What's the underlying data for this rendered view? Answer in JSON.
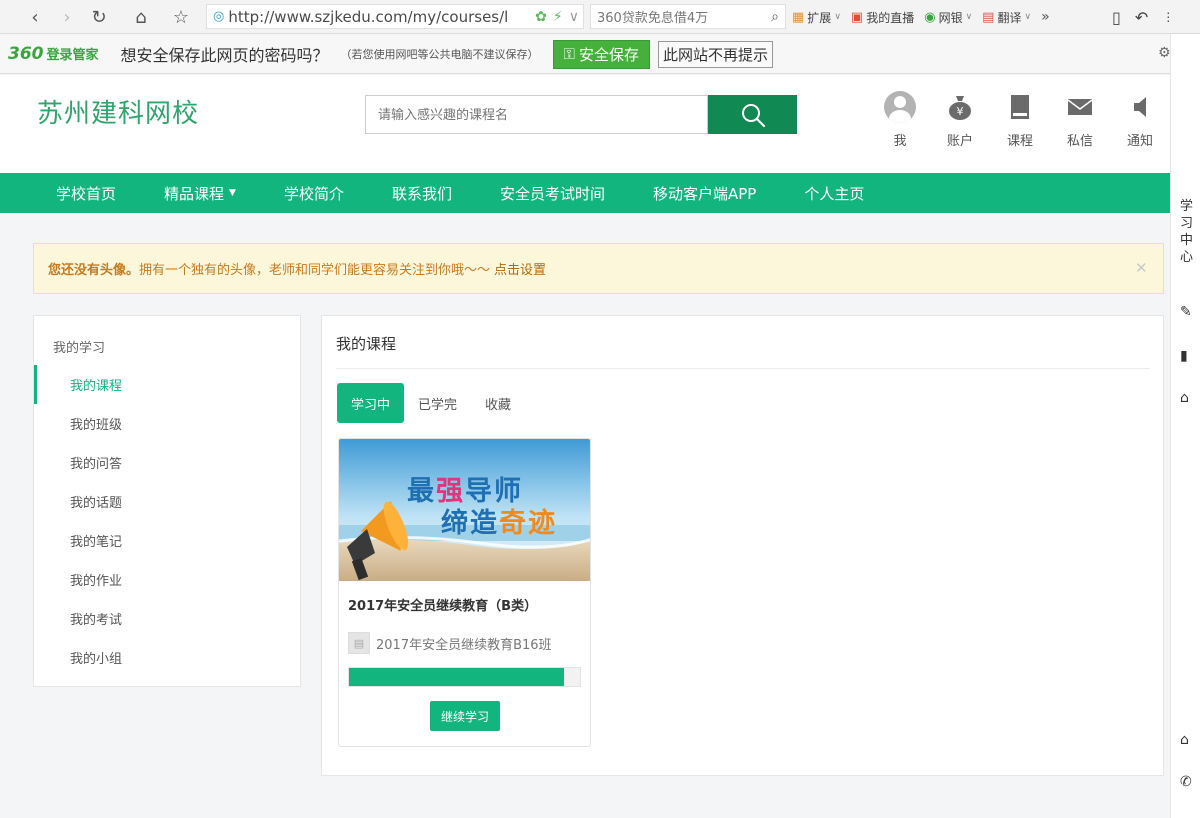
{
  "browser": {
    "url": "http://www.szjkedu.com/my/courses/l",
    "search_text": "360贷款免息借4万",
    "extensions": [
      {
        "icon": "grid-icon",
        "label": "扩展"
      },
      {
        "icon": "tv-icon",
        "label": "我的直播"
      },
      {
        "icon": "bank-icon",
        "label": "网银"
      },
      {
        "icon": "translate-icon",
        "label": "翻译"
      }
    ]
  },
  "password_bar": {
    "brand_num": "360",
    "brand_text": "登录管家",
    "message": "想安全保存此网页的密码吗？",
    "hint": "（若您使用网吧等公共电脑不建议保存）",
    "save_label": "安全保存",
    "dismiss_label": "此网站不再提示"
  },
  "site": {
    "logo": "苏州建科网校",
    "search_placeholder": "请输入感兴趣的课程名",
    "user_menu": [
      {
        "icon": "avatar-icon",
        "label": "我"
      },
      {
        "icon": "money-bag-icon",
        "label": "账户"
      },
      {
        "icon": "book-icon",
        "label": "课程"
      },
      {
        "icon": "envelope-icon",
        "label": "私信"
      },
      {
        "icon": "megaphone-icon",
        "label": "通知"
      }
    ]
  },
  "nav": [
    {
      "label": "学校首页"
    },
    {
      "label": "精品课程",
      "dropdown": true
    },
    {
      "label": "学校简介"
    },
    {
      "label": "联系我们"
    },
    {
      "label": "安全员考试时间"
    },
    {
      "label": "移动客户端APP"
    },
    {
      "label": "个人主页"
    }
  ],
  "side_panel": {
    "study_center": "学习中心"
  },
  "alert": {
    "bold": "您还没有头像。",
    "text": "拥有一个独有的头像，老师和同学们能更容易关注到你哦～～",
    "link": "点击设置"
  },
  "sidebar": {
    "title": "我的学习",
    "items": [
      {
        "label": "我的课程",
        "active": true
      },
      {
        "label": "我的班级"
      },
      {
        "label": "我的问答"
      },
      {
        "label": "我的话题"
      },
      {
        "label": "我的笔记"
      },
      {
        "label": "我的作业"
      },
      {
        "label": "我的考试"
      },
      {
        "label": "我的小组"
      }
    ]
  },
  "main": {
    "title": "我的课程",
    "tabs": [
      {
        "label": "学习中",
        "active": true
      },
      {
        "label": "已学完"
      },
      {
        "label": "收藏"
      }
    ],
    "course": {
      "cover_line1_a": "最",
      "cover_line1_b": "强",
      "cover_line1_c": "导师",
      "cover_line2_a": "缔造",
      "cover_line2_b": "奇迹",
      "title": "2017年安全员继续教育（B类）",
      "class_name": "2017年安全员继续教育B16班",
      "progress_percent": 93,
      "button_label": "继续学习"
    }
  },
  "colors": {
    "primary": "#13b57e",
    "search_button": "#118953",
    "logo": "#2fa56c",
    "alert_text": "#c87a1e"
  }
}
